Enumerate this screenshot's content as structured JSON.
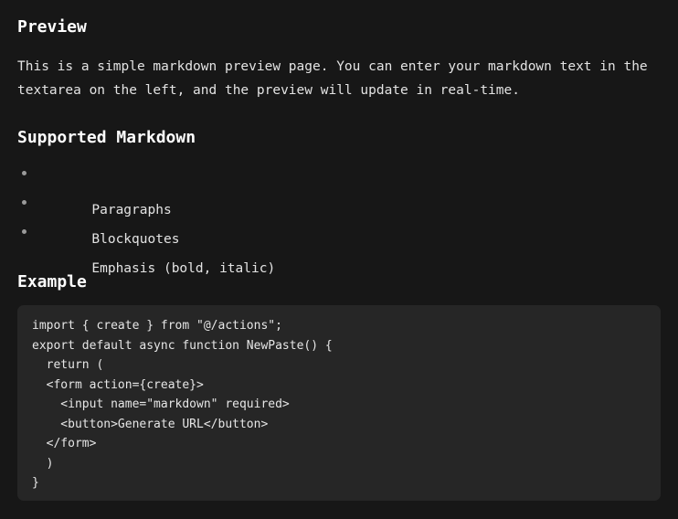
{
  "document": {
    "title": "Preview",
    "colors": {
      "page_background": "#171717",
      "code_background": "#262626",
      "heading_text": "#ffffff",
      "body_text": "#e3e3e3",
      "bullet": "#9a9a9a",
      "code_text": "#e6e6e6"
    },
    "sections": {
      "preview": {
        "heading": "Preview",
        "paragraph": "This is a simple markdown preview page. You can enter your markdown text in the textarea on the left, and the preview will update in real-time."
      },
      "supported_markdown": {
        "heading": "Supported Markdown",
        "items": [
          "Paragraphs",
          "Blockquotes",
          "Emphasis (bold, italic)"
        ]
      },
      "example": {
        "heading": "Example",
        "code": "import { create } from \"@/actions\";\nexport default async function NewPaste() {\n  return (\n  <form action={create}>\n    <input name=\"markdown\" required>\n    <button>Generate URL</button>\n  </form>\n  )\n}"
      }
    }
  }
}
